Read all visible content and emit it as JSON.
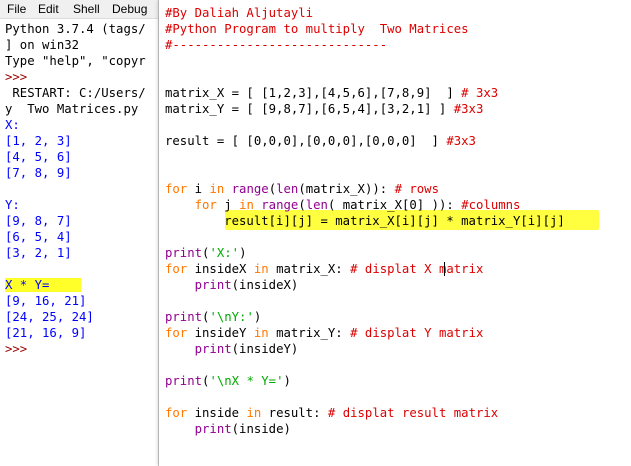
{
  "shell": {
    "menu": [
      "File",
      "Edit",
      "Shell",
      "Debug"
    ],
    "lines": [
      {
        "text": "Python 3.7.4 (tags/",
        "color": "out"
      },
      {
        "text": "] on win32",
        "color": "out"
      },
      {
        "text": "Type \"help\", \"copyr",
        "color": "out"
      },
      {
        "text": ">>>",
        "color": "prompt"
      },
      {
        "text": " RESTART: C:/Users/",
        "color": "out"
      },
      {
        "text": "y  Two Matrices.py",
        "color": "out"
      },
      {
        "text": "X:",
        "color": "res"
      },
      {
        "text": "[1, 2, 3]",
        "color": "res"
      },
      {
        "text": "[4, 5, 6]",
        "color": "res"
      },
      {
        "text": "[7, 8, 9]",
        "color": "res"
      },
      {
        "text": "",
        "color": "res"
      },
      {
        "text": "Y:",
        "color": "res"
      },
      {
        "text": "[9, 8, 7]",
        "color": "res"
      },
      {
        "text": "[6, 5, 4]",
        "color": "res"
      },
      {
        "text": "[3, 2, 1]",
        "color": "res"
      },
      {
        "text": "",
        "color": "res"
      },
      {
        "text": "X * Y=",
        "color": "res",
        "highlight": true
      },
      {
        "text": "[9, 16, 21]",
        "color": "res"
      },
      {
        "text": "[24, 25, 24]",
        "color": "res"
      },
      {
        "text": "[21, 16, 9]",
        "color": "res"
      },
      {
        "text": ">>>",
        "color": "prompt"
      }
    ]
  },
  "editor": {
    "lines": [
      [
        {
          "t": "#By Daliah Aljutayli",
          "c": "cm"
        }
      ],
      [
        {
          "t": "#Python Program to multiply  Two Matrices",
          "c": "cm"
        }
      ],
      [
        {
          "t": "#-----------------------------",
          "c": "cm"
        }
      ],
      [],
      [],
      [
        {
          "t": "matrix_X = [ [1,2,3],[4,5,6],[7,8,9]  ] ",
          "c": "pl"
        },
        {
          "t": "# 3x3",
          "c": "cm"
        }
      ],
      [
        {
          "t": "matrix_Y = [ [9,8,7],[6,5,4],[3,2,1] ] ",
          "c": "pl"
        },
        {
          "t": "#3x3",
          "c": "cm"
        }
      ],
      [],
      [
        {
          "t": "result = [ [0,0,0],[0,0,0],[0,0,0]  ] ",
          "c": "pl"
        },
        {
          "t": "#3x3",
          "c": "cm"
        }
      ],
      [],
      [],
      [
        {
          "t": "for",
          "c": "kw"
        },
        {
          "t": " i ",
          "c": "pl"
        },
        {
          "t": "in",
          "c": "kw"
        },
        {
          "t": " ",
          "c": "pl"
        },
        {
          "t": "range",
          "c": "bi"
        },
        {
          "t": "(",
          "c": "pl"
        },
        {
          "t": "len",
          "c": "bi"
        },
        {
          "t": "(matrix_X)): ",
          "c": "pl"
        },
        {
          "t": "# rows",
          "c": "cm"
        }
      ],
      [
        {
          "t": "    ",
          "c": "pl"
        },
        {
          "t": "for",
          "c": "kw"
        },
        {
          "t": " j ",
          "c": "pl"
        },
        {
          "t": "in",
          "c": "kw"
        },
        {
          "t": " ",
          "c": "pl"
        },
        {
          "t": "range",
          "c": "bi"
        },
        {
          "t": "(",
          "c": "pl"
        },
        {
          "t": "len",
          "c": "bi"
        },
        {
          "t": "( matrix_X[0] )): ",
          "c": "pl"
        },
        {
          "t": "#columns",
          "c": "cm"
        }
      ],
      [
        {
          "t": "        result[i][j] = matrix_X[i][j] * matrix_Y[i][j]",
          "c": "pl"
        }
      ],
      [],
      [
        {
          "t": "print",
          "c": "bi"
        },
        {
          "t": "(",
          "c": "pl"
        },
        {
          "t": "'X:'",
          "c": "st"
        },
        {
          "t": ")",
          "c": "pl"
        }
      ],
      [
        {
          "t": "for",
          "c": "kw"
        },
        {
          "t": " insideX ",
          "c": "pl"
        },
        {
          "t": "in",
          "c": "kw"
        },
        {
          "t": " matrix_X: ",
          "c": "pl"
        },
        {
          "t": "# displat X matrix",
          "c": "cm"
        }
      ],
      [
        {
          "t": "    ",
          "c": "pl"
        },
        {
          "t": "print",
          "c": "bi"
        },
        {
          "t": "(insideX)",
          "c": "pl"
        }
      ],
      [],
      [
        {
          "t": "print",
          "c": "bi"
        },
        {
          "t": "(",
          "c": "pl"
        },
        {
          "t": "'\\nY:'",
          "c": "st"
        },
        {
          "t": ")",
          "c": "pl"
        }
      ],
      [
        {
          "t": "for",
          "c": "kw"
        },
        {
          "t": " insideY ",
          "c": "pl"
        },
        {
          "t": "in",
          "c": "kw"
        },
        {
          "t": " matrix_Y: ",
          "c": "pl"
        },
        {
          "t": "# displat Y matrix",
          "c": "cm"
        }
      ],
      [
        {
          "t": "    ",
          "c": "pl"
        },
        {
          "t": "print",
          "c": "bi"
        },
        {
          "t": "(insideY)",
          "c": "pl"
        }
      ],
      [],
      [
        {
          "t": "print",
          "c": "bi"
        },
        {
          "t": "(",
          "c": "pl"
        },
        {
          "t": "'\\nX * Y='",
          "c": "st"
        },
        {
          "t": ")",
          "c": "pl"
        }
      ],
      [],
      [
        {
          "t": "for",
          "c": "kw"
        },
        {
          "t": " inside ",
          "c": "pl"
        },
        {
          "t": "in",
          "c": "kw"
        },
        {
          "t": " result: ",
          "c": "pl"
        },
        {
          "t": "# displat result matrix",
          "c": "cm"
        }
      ],
      [
        {
          "t": "    ",
          "c": "pl"
        },
        {
          "t": "print",
          "c": "bi"
        },
        {
          "t": "(inside)",
          "c": "pl"
        }
      ]
    ]
  },
  "colors": {
    "comment": "#dd0000",
    "keyword": "#ff7700",
    "builtin": "#900090",
    "string": "#00aa00",
    "output": "#0000ff",
    "prompt": "#9a0000",
    "highlight": "#ffff2a"
  }
}
